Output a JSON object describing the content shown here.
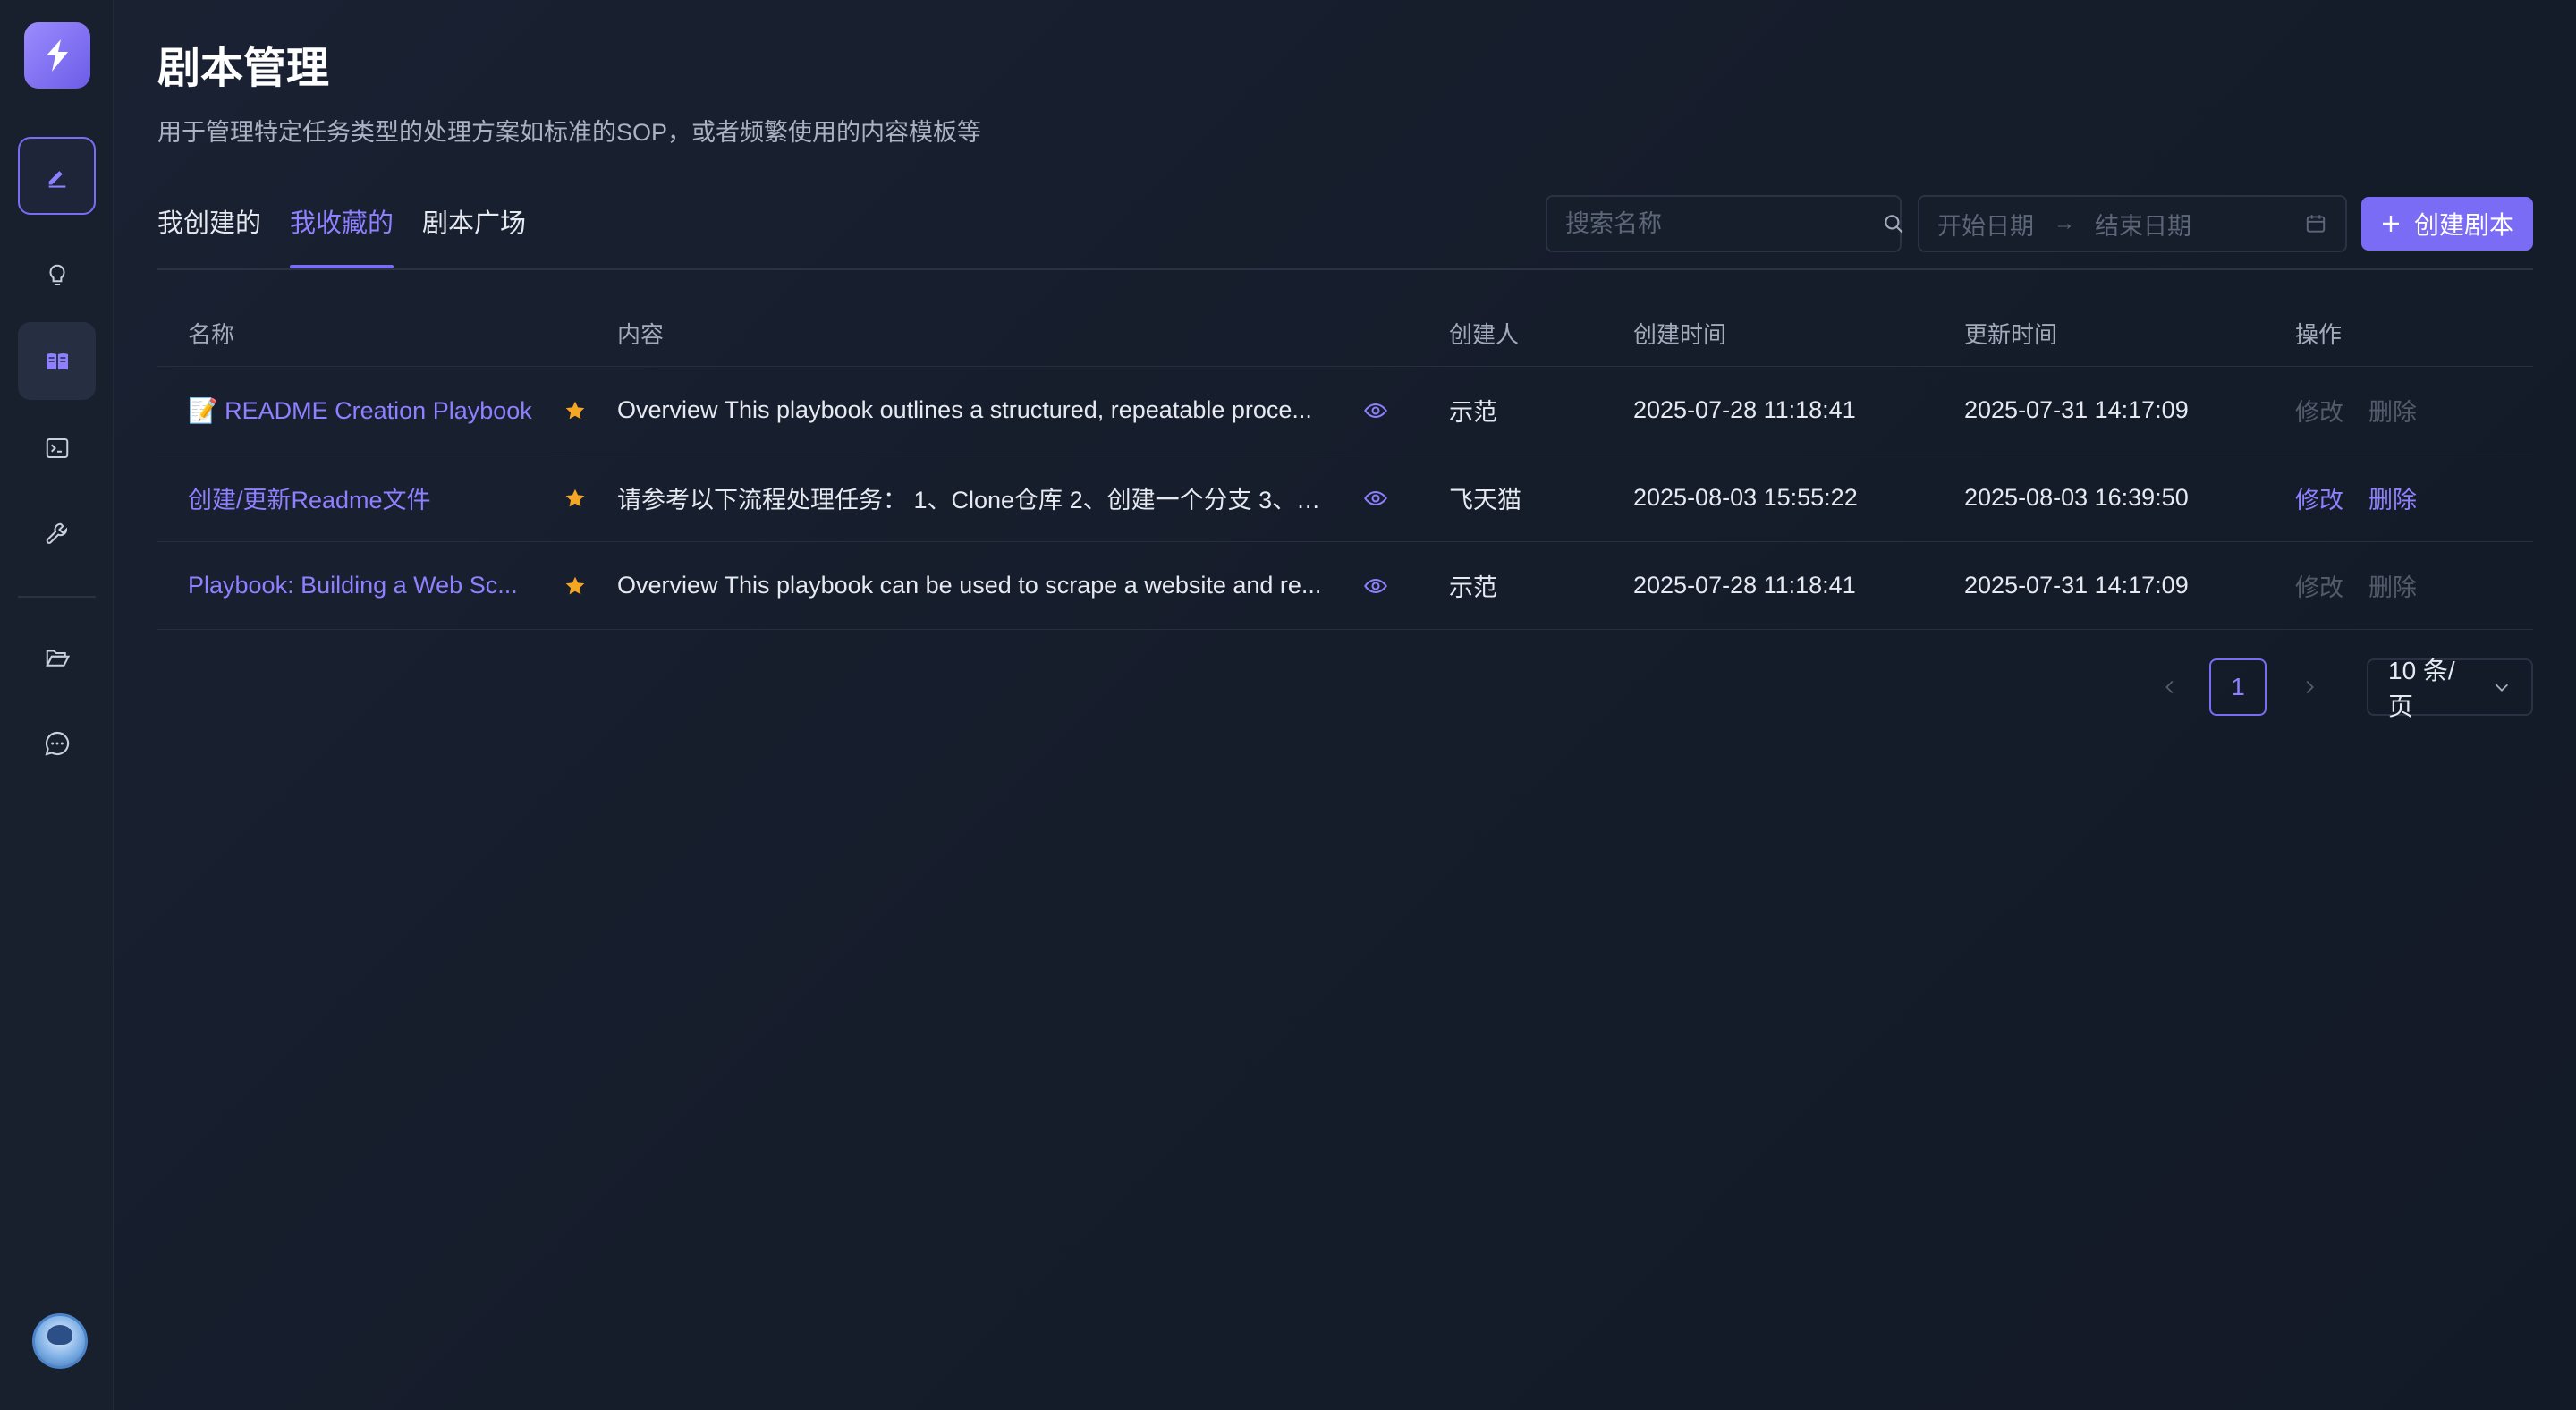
{
  "header": {
    "title": "剧本管理",
    "description": "用于管理特定任务类型的处理方案如标准的SOP，或者频繁使用的内容模板等"
  },
  "tabs": [
    {
      "label": "我创建的",
      "active": false
    },
    {
      "label": "我收藏的",
      "active": true
    },
    {
      "label": "剧本广场",
      "active": false
    }
  ],
  "toolbar": {
    "search_placeholder": "搜索名称",
    "start_date_placeholder": "开始日期",
    "end_date_placeholder": "结束日期",
    "date_separator": "→",
    "create_label": "创建剧本"
  },
  "table": {
    "columns": [
      "名称",
      "内容",
      "创建人",
      "创建时间",
      "更新时间",
      "操作"
    ],
    "rows": [
      {
        "name": "📝 README Creation Playbook",
        "content": "Overview This playbook outlines a structured, repeatable proce...",
        "creator": "示范",
        "created": "2025-07-28 11:18:41",
        "updated": "2025-07-31 14:17:09",
        "edit": "修改",
        "delete": "删除",
        "ops_enabled": false
      },
      {
        "name": "创建/更新Readme文件",
        "content": "请参考以下流程处理任务： 1、Clone仓库 2、创建一个分支 3、阅...",
        "creator": "飞天猫",
        "created": "2025-08-03 15:55:22",
        "updated": "2025-08-03 16:39:50",
        "edit": "修改",
        "delete": "删除",
        "ops_enabled": true
      },
      {
        "name": "Playbook: Building a Web Sc...",
        "content": "Overview This playbook can be used to scrape a website and re...",
        "creator": "示范",
        "created": "2025-07-28 11:18:41",
        "updated": "2025-07-31 14:17:09",
        "edit": "修改",
        "delete": "删除",
        "ops_enabled": false
      }
    ]
  },
  "pagination": {
    "current_page": "1",
    "page_size": "10 条/页"
  },
  "colors": {
    "accent": "#7b6cf6",
    "star": "#f5a623",
    "background": "#151c2a"
  }
}
